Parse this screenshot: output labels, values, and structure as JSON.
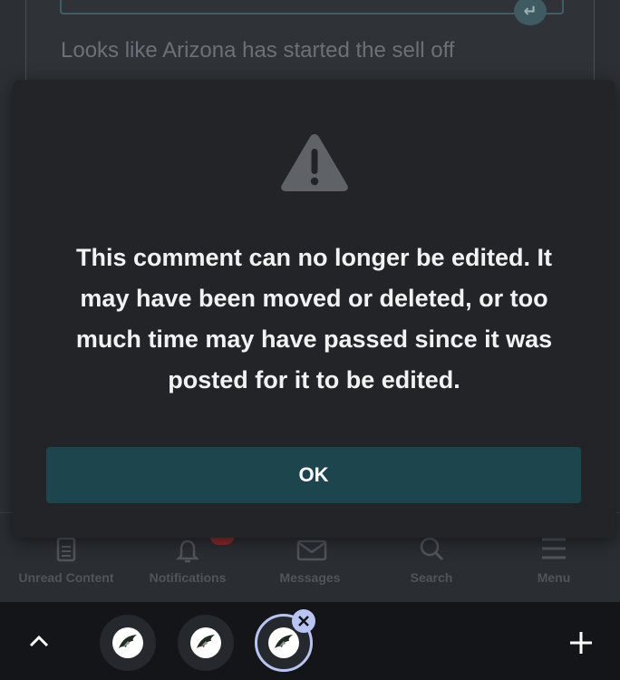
{
  "background": {
    "comment_preview": "Looks like Arizona has started the sell off"
  },
  "bottom_nav": {
    "items": [
      {
        "label": "Unread Content",
        "icon": "document-icon"
      },
      {
        "label": "Notifications",
        "icon": "bell-icon"
      },
      {
        "label": "Messages",
        "icon": "envelope-icon"
      },
      {
        "label": "Search",
        "icon": "search-icon"
      },
      {
        "label": "Menu",
        "icon": "menu-icon"
      }
    ]
  },
  "modal": {
    "icon": "warning-icon",
    "message": "This comment can no longer be edited. It may have been moved or deleted, or too much time may have passed since it was posted for it to be edited.",
    "ok_label": "OK"
  },
  "tab_strip": {
    "tabs": [
      {
        "icon": "eagle-favicon",
        "active": false
      },
      {
        "icon": "eagle-favicon",
        "active": false
      },
      {
        "icon": "eagle-favicon",
        "active": true
      }
    ]
  },
  "colors": {
    "modal_bg": "#222427",
    "ok_button": "#1c454d",
    "active_tab_ring": "#b8c5f2",
    "notification_badge": "#8c2a2a"
  }
}
